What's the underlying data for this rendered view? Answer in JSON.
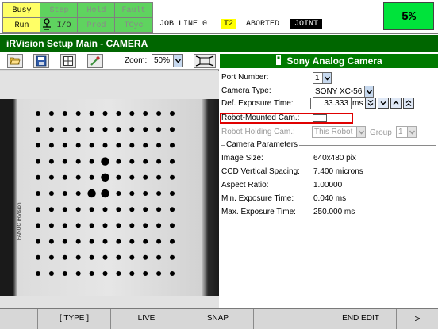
{
  "status": {
    "indicators": [
      {
        "label": "Busy",
        "on": true
      },
      {
        "label": "Step",
        "on": false
      },
      {
        "label": "Hold",
        "on": false
      },
      {
        "label": "Fault",
        "on": false
      },
      {
        "label": "Run",
        "on": true
      },
      {
        "label": "I/O",
        "on": false
      },
      {
        "label": "Prod",
        "on": false
      },
      {
        "label": "TCyc",
        "on": false
      }
    ],
    "line": "JOB LINE 0",
    "task": "T2",
    "state": "ABORTED",
    "coord": "JOINT",
    "override": "5%"
  },
  "title": "iRVision Setup Main - CAMERA",
  "toolbar": {
    "open_icon": "folder-open-icon",
    "save_icon": "save-icon",
    "grid_icon": "grid-icon",
    "eyedropper_icon": "eyedropper-icon",
    "zoom_label": "Zoom:",
    "zoom_value": "50%",
    "fit_icon": "fit-window-icon"
  },
  "camera": {
    "header_icon": "camera-icon",
    "header": "Sony Analog Camera",
    "port_number_label": "Port Number:",
    "port_number_value": "1",
    "camera_type_label": "Camera Type:",
    "camera_type_value": "SONY XC-56",
    "exposure_label": "Def. Exposure Time:",
    "exposure_value": "33.333",
    "exposure_unit": "ms",
    "robot_mounted_label": "Robot-Mounted Cam.:",
    "robot_mounted_checked": false,
    "robot_holding_label": "Robot Holding Cam.:",
    "robot_holding_value": "This Robot",
    "group_label": "Group",
    "group_value": "1"
  },
  "parameters": {
    "section_title": "Camera Parameters",
    "rows": [
      {
        "label": "Image Size:",
        "value": "640x480 pix"
      },
      {
        "label": "CCD Vertical Spacing:",
        "value": "7.400 microns"
      },
      {
        "label": "Aspect Ratio:",
        "value": "1.00000"
      },
      {
        "label": "Min. Exposure Time:",
        "value": "0.040 ms"
      },
      {
        "label": "Max. Exposure Time:",
        "value": "250.000 ms"
      }
    ]
  },
  "image": {
    "plate_text": "FANUC iRVision",
    "grid_rows": 11,
    "grid_cols": 11,
    "large_dots": [
      [
        3,
        5
      ],
      [
        4,
        5
      ],
      [
        5,
        4
      ],
      [
        5,
        5
      ]
    ]
  },
  "fkeys": [
    "[ TYPE ]",
    "LIVE",
    "SNAP",
    "",
    "END EDIT",
    ">"
  ],
  "colors": {
    "title_green": "#006600",
    "header_green": "#007a00",
    "override_green": "#00e33b",
    "busy_yellow": "#ffff66",
    "idle_green": "#5fd35f",
    "highlight_red": "#e00000"
  }
}
